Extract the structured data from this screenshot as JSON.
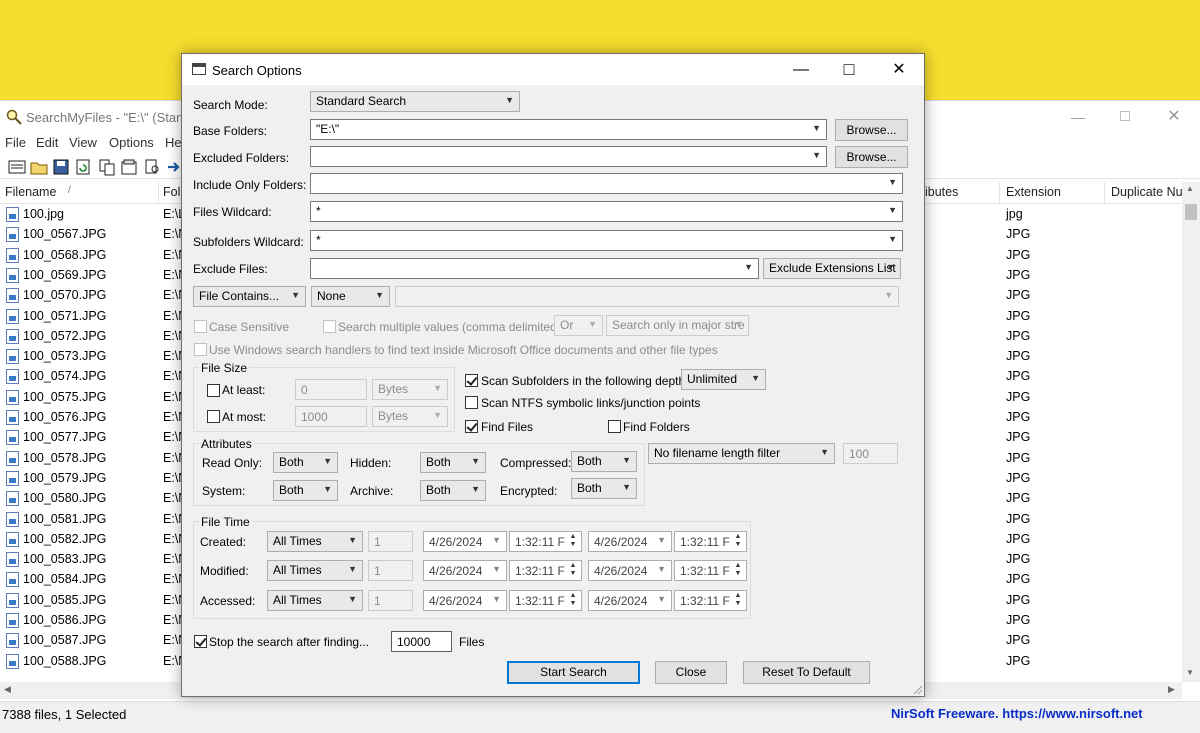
{
  "main_window": {
    "title": "SearchMyFiles -  \"E:\\\"  (Stan",
    "menu": [
      "File",
      "Edit",
      "View",
      "Options",
      "He"
    ],
    "columns": {
      "filename": "Filename",
      "folder": "Fol",
      "attributes": "ibutes",
      "extension": "Extension",
      "duplicate": "Duplicate Nu"
    },
    "rows": [
      {
        "name": "100.jpg",
        "folder": "E:\\L",
        "ext": "jpg"
      },
      {
        "name": "100_0567.JPG",
        "folder": "E:\\N",
        "ext": "JPG"
      },
      {
        "name": "100_0568.JPG",
        "folder": "E:\\N",
        "ext": "JPG"
      },
      {
        "name": "100_0569.JPG",
        "folder": "E:\\N",
        "ext": "JPG"
      },
      {
        "name": "100_0570.JPG",
        "folder": "E:\\N",
        "ext": "JPG"
      },
      {
        "name": "100_0571.JPG",
        "folder": "E:\\N",
        "ext": "JPG"
      },
      {
        "name": "100_0572.JPG",
        "folder": "E:\\N",
        "ext": "JPG"
      },
      {
        "name": "100_0573.JPG",
        "folder": "E:\\N",
        "ext": "JPG"
      },
      {
        "name": "100_0574.JPG",
        "folder": "E:\\N",
        "ext": "JPG"
      },
      {
        "name": "100_0575.JPG",
        "folder": "E:\\N",
        "ext": "JPG"
      },
      {
        "name": "100_0576.JPG",
        "folder": "E:\\N",
        "ext": "JPG"
      },
      {
        "name": "100_0577.JPG",
        "folder": "E:\\N",
        "ext": "JPG"
      },
      {
        "name": "100_0578.JPG",
        "folder": "E:\\N",
        "ext": "JPG"
      },
      {
        "name": "100_0579.JPG",
        "folder": "E:\\N",
        "ext": "JPG"
      },
      {
        "name": "100_0580.JPG",
        "folder": "E:\\N",
        "ext": "JPG"
      },
      {
        "name": "100_0581.JPG",
        "folder": "E:\\N",
        "ext": "JPG"
      },
      {
        "name": "100_0582.JPG",
        "folder": "E:\\N",
        "ext": "JPG"
      },
      {
        "name": "100_0583.JPG",
        "folder": "E:\\N",
        "ext": "JPG"
      },
      {
        "name": "100_0584.JPG",
        "folder": "E:\\N",
        "ext": "JPG"
      },
      {
        "name": "100_0585.JPG",
        "folder": "E:\\N",
        "ext": "JPG"
      },
      {
        "name": "100_0586.JPG",
        "folder": "E:\\N",
        "ext": "JPG"
      },
      {
        "name": "100_0587.JPG",
        "folder": "E:\\N",
        "ext": "JPG"
      },
      {
        "name": "100_0588.JPG",
        "folder": "E:\\N",
        "ext": "JPG"
      }
    ],
    "status_left": "7388 files, 1 Selected",
    "status_right": "NirSoft Freeware. https://www.nirsoft.net"
  },
  "dialog": {
    "title": "Search Options",
    "search_mode_label": "Search Mode:",
    "search_mode_value": "Standard Search",
    "base_folders_label": "Base Folders:",
    "base_folders_value": "\"E:\\\"",
    "browse_label": "Browse...",
    "excluded_folders_label": "Excluded Folders:",
    "excluded_folders_value": "",
    "include_only_label": "Include Only Folders:",
    "include_only_value": "",
    "files_wildcard_label": "Files Wildcard:",
    "files_wildcard_value": "*",
    "subfolders_wildcard_label": "Subfolders Wildcard:",
    "subfolders_wildcard_value": "*",
    "exclude_files_label": "Exclude Files:",
    "exclude_files_value": "",
    "exclude_ext_value": "Exclude Extensions List",
    "file_contains_value": "File Contains...",
    "contains_mode_value": "None",
    "case_sensitive_label": "Case Sensitive",
    "search_multiple_label": "Search multiple values (comma delimited)",
    "or_value": "Or",
    "search_major_value": "Search only in major stre",
    "windows_handlers_label": "Use Windows search handlers to find text inside Microsoft Office documents and other file types",
    "file_size": {
      "group_label": "File Size",
      "at_least_label": "At least:",
      "at_least_value": "0",
      "at_least_unit": "Bytes",
      "at_most_label": "At most:",
      "at_most_value": "1000",
      "at_most_unit": "Bytes"
    },
    "scan_subfolders_label": "Scan Subfolders in the following depth:",
    "scan_depth_value": "Unlimited",
    "scan_ntfs_label": "Scan NTFS symbolic links/junction points",
    "find_files_label": "Find Files",
    "find_folders_label": "Find Folders",
    "attributes": {
      "group_label": "Attributes",
      "read_only_label": "Read Only:",
      "hidden_label": "Hidden:",
      "compressed_label": "Compressed:",
      "system_label": "System:",
      "archive_label": "Archive:",
      "encrypted_label": "Encrypted:",
      "read_only_value": "Both",
      "hidden_value": "Both",
      "compressed_value": "Both",
      "system_value": "Both",
      "archive_value": "Both",
      "encrypted_value": "Both"
    },
    "filename_length_value": "No filename length filter",
    "filename_length_num": "100",
    "file_time": {
      "group_label": "File Time",
      "rows": [
        {
          "label": "Created:",
          "mode": "All Times",
          "num": "1",
          "date1": "4/26/2024",
          "time1": "1:32:11 F",
          "date2": "4/26/2024",
          "time2": "1:32:11 F"
        },
        {
          "label": "Modified:",
          "mode": "All Times",
          "num": "1",
          "date1": "4/26/2024",
          "time1": "1:32:11 F",
          "date2": "4/26/2024",
          "time2": "1:32:11 F"
        },
        {
          "label": "Accessed:",
          "mode": "All Times",
          "num": "1",
          "date1": "4/26/2024",
          "time1": "1:32:11 F",
          "date2": "4/26/2024",
          "time2": "1:32:11 F"
        }
      ]
    },
    "stop_search_label": "Stop the search after finding...",
    "stop_search_value": "10000",
    "files_label": "Files",
    "start_search_label": "Start Search",
    "close_label": "Close",
    "reset_label": "Reset To Default"
  }
}
